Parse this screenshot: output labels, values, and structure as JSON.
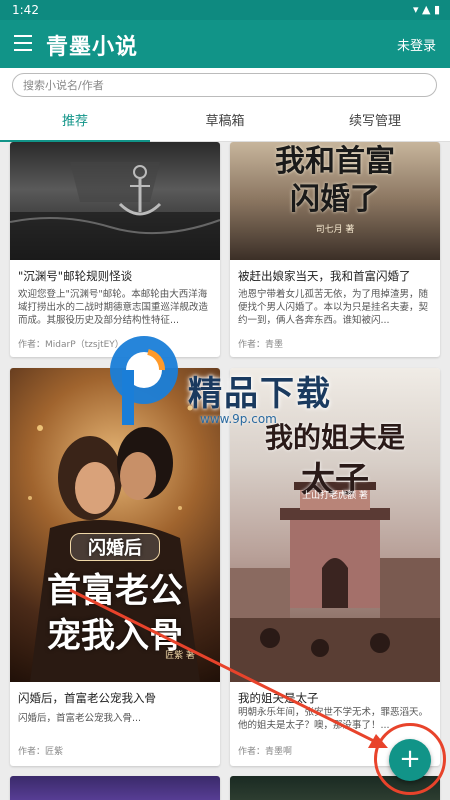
{
  "status_bar": {
    "time": "1:42",
    "icons": "▾ ▲ ▮"
  },
  "app_bar": {
    "title": "青墨小说",
    "login": "未登录"
  },
  "search": {
    "placeholder": "搜索小说名/作者"
  },
  "tabs": [
    {
      "label": "推荐",
      "active": true
    },
    {
      "label": "草稿箱",
      "active": false
    },
    {
      "label": "续写管理",
      "active": false
    }
  ],
  "books": [
    {
      "title": "\"沉渊号\"邮轮规则怪谈",
      "desc": "欢迎您登上\"沉渊号\"邮轮。本邮轮由大西洋海域打捞出水的二战时期德意志国重巡洋舰改造而成。其服役历史及部分结构性特征...",
      "author": "作者：MidarP（tzsjtEY）"
    },
    {
      "title": "被赶出娘家当天，我和首富闪婚了",
      "desc": "池恩宁带着女儿孤苦无依，为了甩掉渣男，随便找个男人闪婚了。本以为只是挂名夫妻，契约一到，俩人各奔东西。谁知被闪...",
      "author": "作者：青墨",
      "cover_lines": [
        "我和首富",
        "闪婚了"
      ],
      "cover_author": "司七月 著"
    },
    {
      "title": "闪婚后，首富老公宠我入骨",
      "desc": "闪婚后，首富老公宠我入骨...",
      "author": "作者：匠紫",
      "cover_lines": [
        "闪婚后",
        "首富老公",
        "宠我入骨"
      ],
      "cover_author": "匠紫 著"
    },
    {
      "title": "我的姐夫是太子",
      "desc": "明朝永乐年间，张安世不学无术，罪恶滔天。他的姐夫是太子？噢，那没事了！...",
      "author": "作者：青墨啊",
      "cover_lines": [
        "我的姐夫是",
        "太子"
      ],
      "cover_author": "上山打老虎额 著"
    }
  ],
  "watermark": {
    "text": "精品下载",
    "url": "www.9p.com"
  },
  "fab": {
    "label": "+"
  },
  "colors": {
    "primary": "#119488",
    "annotation": "#e8432b"
  }
}
